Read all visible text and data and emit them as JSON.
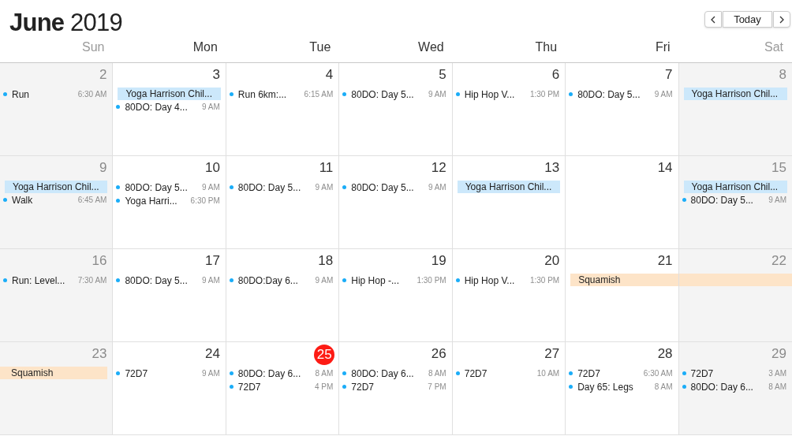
{
  "title": {
    "month": "June",
    "year": "2019"
  },
  "nav": {
    "today": "Today"
  },
  "weekdays": [
    {
      "label": "Sun",
      "weekend": true
    },
    {
      "label": "Mon",
      "weekend": false
    },
    {
      "label": "Tue",
      "weekend": false
    },
    {
      "label": "Wed",
      "weekend": false
    },
    {
      "label": "Thu",
      "weekend": false
    },
    {
      "label": "Fri",
      "weekend": false
    },
    {
      "label": "Sat",
      "weekend": true
    }
  ],
  "weeks": [
    {
      "days": [
        {
          "date": "2",
          "weekend": true,
          "today": false,
          "events": [
            {
              "kind": "timed",
              "title": "Run",
              "time": "6:30 AM"
            }
          ]
        },
        {
          "date": "3",
          "weekend": false,
          "today": false,
          "events": [
            {
              "kind": "allday",
              "title": "Yoga Harrison Chil...",
              "color": "#cce8fb",
              "continued": false,
              "continues": false
            },
            {
              "kind": "timed",
              "title": "80DO: Day 4...",
              "time": "9 AM"
            }
          ]
        },
        {
          "date": "4",
          "weekend": false,
          "today": false,
          "events": [
            {
              "kind": "timed",
              "title": "Run 6km:...",
              "time": "6:15 AM"
            }
          ]
        },
        {
          "date": "5",
          "weekend": false,
          "today": false,
          "events": [
            {
              "kind": "timed",
              "title": "80DO: Day 5...",
              "time": "9 AM"
            }
          ]
        },
        {
          "date": "6",
          "weekend": false,
          "today": false,
          "events": [
            {
              "kind": "timed",
              "title": "Hip Hop V...",
              "time": "1:30 PM"
            }
          ]
        },
        {
          "date": "7",
          "weekend": false,
          "today": false,
          "events": [
            {
              "kind": "timed",
              "title": "80DO: Day 5...",
              "time": "9 AM"
            }
          ]
        },
        {
          "date": "8",
          "weekend": true,
          "today": false,
          "events": [
            {
              "kind": "allday",
              "title": "Yoga Harrison Chil...",
              "color": "#cce8fb",
              "continued": false,
              "continues": false
            }
          ]
        }
      ]
    },
    {
      "days": [
        {
          "date": "9",
          "weekend": true,
          "today": false,
          "events": [
            {
              "kind": "allday",
              "title": "Yoga Harrison Chil...",
              "color": "#cce8fb",
              "continued": false,
              "continues": false
            },
            {
              "kind": "timed",
              "title": "Walk",
              "time": "6:45 AM"
            }
          ]
        },
        {
          "date": "10",
          "weekend": false,
          "today": false,
          "events": [
            {
              "kind": "timed",
              "title": "80DO: Day 5...",
              "time": "9 AM"
            },
            {
              "kind": "timed",
              "title": "Yoga Harri...",
              "time": "6:30 PM"
            }
          ]
        },
        {
          "date": "11",
          "weekend": false,
          "today": false,
          "events": [
            {
              "kind": "timed",
              "title": "80DO: Day 5...",
              "time": "9 AM"
            }
          ]
        },
        {
          "date": "12",
          "weekend": false,
          "today": false,
          "events": [
            {
              "kind": "timed",
              "title": "80DO: Day 5...",
              "time": "9 AM"
            }
          ]
        },
        {
          "date": "13",
          "weekend": false,
          "today": false,
          "events": [
            {
              "kind": "allday",
              "title": "Yoga Harrison Chil...",
              "color": "#cce8fb",
              "continued": false,
              "continues": false
            }
          ]
        },
        {
          "date": "14",
          "weekend": false,
          "today": false
        },
        {
          "date": "15",
          "weekend": true,
          "today": false,
          "events": [
            {
              "kind": "allday",
              "title": "Yoga Harrison Chil...",
              "color": "#cce8fb",
              "continued": false,
              "continues": false
            },
            {
              "kind": "timed",
              "title": "80DO: Day 5...",
              "time": "9 AM"
            }
          ]
        }
      ]
    },
    {
      "days": [
        {
          "date": "16",
          "weekend": true,
          "today": false,
          "events": [
            {
              "kind": "timed",
              "title": "Run: Level...",
              "time": "7:30 AM"
            }
          ]
        },
        {
          "date": "17",
          "weekend": false,
          "today": false,
          "events": [
            {
              "kind": "timed",
              "title": "80DO: Day 5...",
              "time": "9 AM"
            }
          ]
        },
        {
          "date": "18",
          "weekend": false,
          "today": false,
          "events": [
            {
              "kind": "timed",
              "title": "80DO:Day 6...",
              "time": "9 AM"
            }
          ]
        },
        {
          "date": "19",
          "weekend": false,
          "today": false,
          "events": [
            {
              "kind": "timed",
              "title": "Hip Hop -...",
              "time": "1:30 PM"
            }
          ]
        },
        {
          "date": "20",
          "weekend": false,
          "today": false,
          "events": [
            {
              "kind": "timed",
              "title": "Hip Hop V...",
              "time": "1:30 PM"
            }
          ]
        },
        {
          "date": "21",
          "weekend": false,
          "today": false,
          "events": [
            {
              "kind": "allday",
              "title": "Squamish",
              "color": "#fde4c8",
              "continued": false,
              "continues": true
            }
          ]
        },
        {
          "date": "22",
          "weekend": true,
          "today": false
        }
      ]
    },
    {
      "days": [
        {
          "date": "23",
          "weekend": true,
          "today": false,
          "events": [
            {
              "kind": "allday",
              "title": "Squamish",
              "color": "#fde4c8",
              "continued": true,
              "continues": false
            }
          ]
        },
        {
          "date": "24",
          "weekend": false,
          "today": false,
          "events": [
            {
              "kind": "timed",
              "title": "72D7",
              "time": "9 AM"
            }
          ]
        },
        {
          "date": "25",
          "weekend": false,
          "today": true,
          "events": [
            {
              "kind": "timed",
              "title": "80DO: Day 6...",
              "time": "8 AM"
            },
            {
              "kind": "timed",
              "title": "72D7",
              "time": "4 PM"
            }
          ]
        },
        {
          "date": "26",
          "weekend": false,
          "today": false,
          "events": [
            {
              "kind": "timed",
              "title": "80DO: Day 6...",
              "time": "8 AM"
            },
            {
              "kind": "timed",
              "title": "72D7",
              "time": "7 PM"
            }
          ]
        },
        {
          "date": "27",
          "weekend": false,
          "today": false,
          "events": [
            {
              "kind": "timed",
              "title": "72D7",
              "time": "10 AM"
            }
          ]
        },
        {
          "date": "28",
          "weekend": false,
          "today": false,
          "events": [
            {
              "kind": "timed",
              "title": "72D7",
              "time": "6:30 AM"
            },
            {
              "kind": "timed",
              "title": "Day 65: Legs",
              "time": "8 AM"
            }
          ]
        },
        {
          "date": "29",
          "weekend": true,
          "today": false,
          "events": [
            {
              "kind": "timed",
              "title": "72D7",
              "time": "3 AM"
            },
            {
              "kind": "timed",
              "title": "80DO: Day 6...",
              "time": "8 AM"
            }
          ]
        }
      ]
    }
  ]
}
